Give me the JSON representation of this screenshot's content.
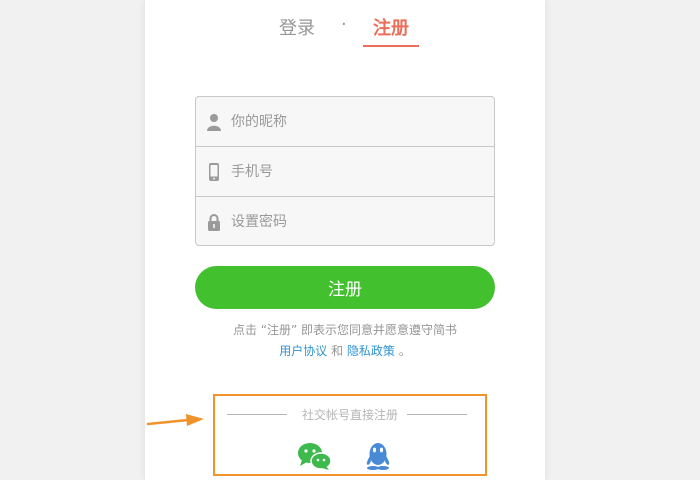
{
  "tabs": {
    "login_label": "登录",
    "separator": "·",
    "register_label": "注册"
  },
  "form": {
    "nickname_placeholder": "你的昵称",
    "phone_placeholder": "手机号",
    "password_placeholder": "设置密码"
  },
  "submit_label": "注册",
  "agreement": {
    "prefix": "点击 “注册” 即表示您同意并愿意遵守简书",
    "user_agreement_link": "用户协议",
    "and_text": "和",
    "privacy_link": "隐私政策",
    "suffix": "。"
  },
  "social": {
    "title": "社交帐号直接注册",
    "icons": [
      "wechat-icon",
      "qq-icon"
    ]
  },
  "colors": {
    "accent": "#ea6f5a",
    "submit_green": "#42c02e",
    "link_blue": "#3194d0",
    "highlight_orange": "#f0932b"
  }
}
